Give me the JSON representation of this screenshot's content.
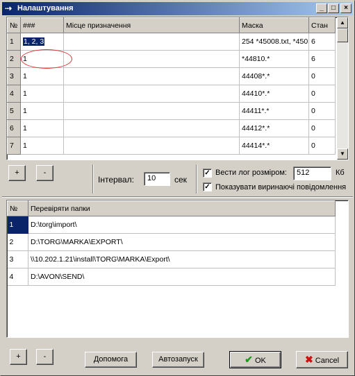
{
  "window": {
    "title": "Налаштування",
    "app_icon": "arrow-icon"
  },
  "masks_table": {
    "headers": [
      "№",
      "###",
      "Місце призначення",
      "Маска",
      "Стан"
    ],
    "rows": [
      {
        "n": "1",
        "code": "1, 2, 3",
        "dest": "",
        "mask": "254 *45008.txt, *450",
        "state": "6"
      },
      {
        "n": "2",
        "code": "1",
        "dest": "",
        "mask": "*44810.*",
        "state": "6"
      },
      {
        "n": "3",
        "code": "1",
        "dest": "",
        "mask": "44408*.*",
        "state": "0"
      },
      {
        "n": "4",
        "code": "1",
        "dest": "",
        "mask": "44410*.*",
        "state": "0"
      },
      {
        "n": "5",
        "code": "1",
        "dest": "",
        "mask": "44411*.*",
        "state": "0"
      },
      {
        "n": "6",
        "code": "1",
        "dest": "",
        "mask": "44412*.*",
        "state": "0"
      },
      {
        "n": "7",
        "code": "1",
        "dest": "",
        "mask": "44414*.*",
        "state": "0"
      }
    ]
  },
  "settings": {
    "add_label": "+",
    "remove_label": "-",
    "interval_label": "Інтервал:",
    "interval_value": "10",
    "interval_unit": "сек",
    "log_label": "Вести лог розміром:",
    "log_checked": true,
    "log_size": "512",
    "log_unit": "Кб",
    "popups_label": "Показувати виринаючі повідомлення",
    "popups_checked": true
  },
  "folders_table": {
    "headers": [
      "№",
      "Перевіряти папки"
    ],
    "rows": [
      {
        "n": "1",
        "path": "D:\\torg\\import\\"
      },
      {
        "n": "2",
        "path": "D:\\TORG\\MARKA\\EXPORT\\"
      },
      {
        "n": "3",
        "path": "\\\\10.202.1.21\\install\\TORG\\MARKA\\Export\\"
      },
      {
        "n": "4",
        "path": "D:\\AVON\\SEND\\"
      }
    ]
  },
  "footer": {
    "add_label": "+",
    "remove_label": "-",
    "help_label": "Допомога",
    "autostart_label": "Автозапуск",
    "ok_label": "OK",
    "cancel_label": "Cancel"
  },
  "colors": {
    "title_start": "#0a246a",
    "title_end": "#a6caf0",
    "selection": "#0a246a",
    "ok_check": "#1a9a1a",
    "cancel_x": "#d01010",
    "highlight_ellipse": "#e03030"
  }
}
